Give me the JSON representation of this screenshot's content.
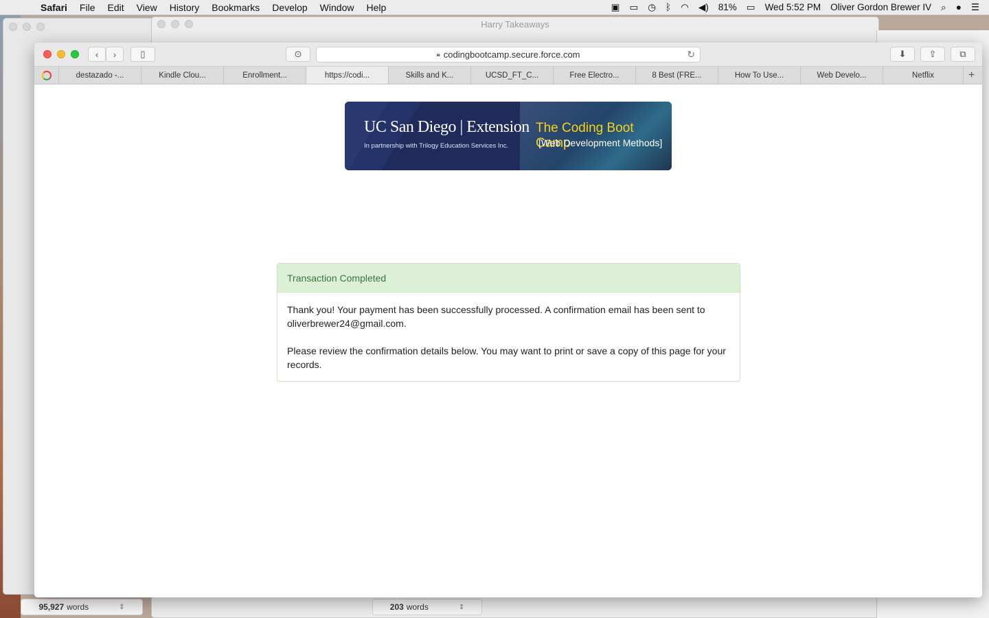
{
  "menubar": {
    "app": "Safari",
    "items": [
      "File",
      "Edit",
      "View",
      "History",
      "Bookmarks",
      "Develop",
      "Window",
      "Help"
    ],
    "battery": "81%",
    "clock": "Wed 5:52 PM",
    "user": "Oliver Gordon Brewer IV"
  },
  "background": {
    "doc_title": "Harry Takeaways",
    "left_words_count": "95,927",
    "left_words_label": "words",
    "mid_words_count": "203",
    "mid_words_label": "words"
  },
  "browser": {
    "url": "codingbootcamp.secure.force.com",
    "tabs": [
      {
        "label": "destazado -..."
      },
      {
        "label": "Kindle Clou..."
      },
      {
        "label": "Enrollment..."
      },
      {
        "label": "https://codi..."
      },
      {
        "label": "Skills and K..."
      },
      {
        "label": "UCSD_FT_C..."
      },
      {
        "label": "Free Electro..."
      },
      {
        "label": "8 Best (FRE..."
      },
      {
        "label": "How To Use..."
      },
      {
        "label": "Web Develo..."
      },
      {
        "label": "Netflix"
      }
    ],
    "active_tab": 3
  },
  "banner": {
    "ucsd": "UC San Diego | Extension",
    "partner": "In partnership with Trilogy Education Services Inc.",
    "bootcamp_title": "The Coding Boot Camp",
    "bootcamp_sub": "[Web Development Methods]"
  },
  "panel": {
    "heading": "Transaction Completed",
    "para1": "Thank you! Your payment has been successfully processed. A confirmation email has been sent to oliverbrewer24@gmail.com.",
    "para2": "Please review the confirmation details below. You may want to print or save a copy of this page for your records."
  },
  "colors": {
    "success_bg": "#dbf0d5",
    "success_text": "#3c763d",
    "banner_bg": "#1f2b5a",
    "banner_accent": "#f7d117"
  }
}
